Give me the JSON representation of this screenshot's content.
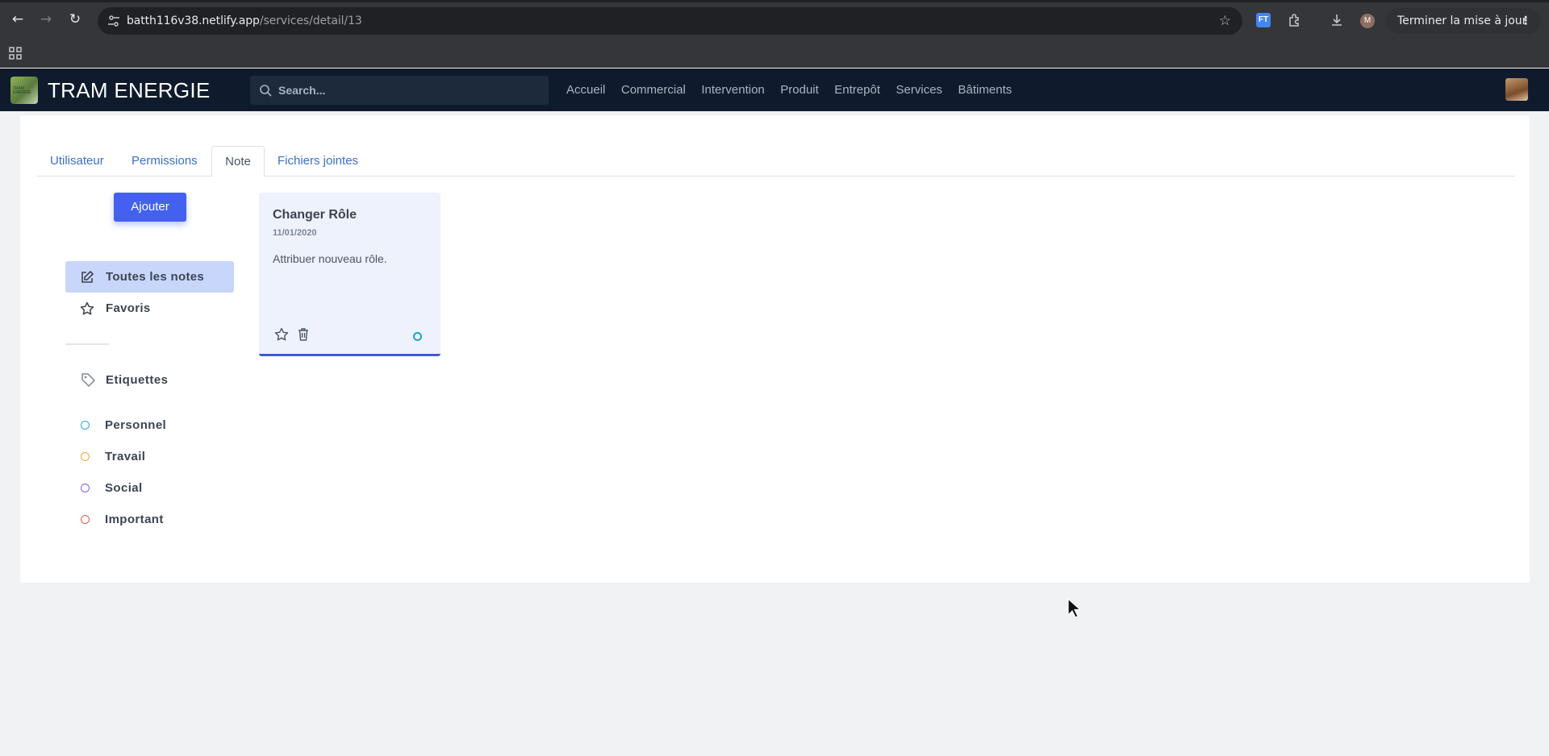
{
  "browser": {
    "url_host": "batth116v38.netlify.app",
    "url_path": "/services/detail/13",
    "extension_label": "FT",
    "profile_initial": "M",
    "update_button": "Terminer la mise à jour"
  },
  "header": {
    "brand": "TRAM ENERGIE",
    "logo_text": "TRAM ENERGIE",
    "search_placeholder": "Search...",
    "nav": [
      "Accueil",
      "Commercial",
      "Intervention",
      "Produit",
      "Entrepôt",
      "Services",
      "Bâtiments"
    ]
  },
  "tabs": {
    "items": [
      "Utilisateur",
      "Permissions",
      "Note",
      "Fichiers jointes"
    ],
    "active": "Note"
  },
  "notes_panel": {
    "add_button": "Ajouter",
    "filters": [
      {
        "label": "Toutes les notes",
        "icon": "edit-icon",
        "active": true
      },
      {
        "label": "Favoris",
        "icon": "star-icon",
        "active": false
      }
    ],
    "labels_title": "Etiquettes",
    "labels": [
      {
        "label": "Personnel",
        "color": "#2ea7d8"
      },
      {
        "label": "Travail",
        "color": "#e8a93a"
      },
      {
        "label": "Social",
        "color": "#8a63d2"
      },
      {
        "label": "Important",
        "color": "#e25a4a"
      }
    ]
  },
  "notes": [
    {
      "title": "Changer Rôle",
      "date": "11/01/2020",
      "text": "Attribuer nouveau rôle.",
      "tag_color": "#1fa4c4"
    }
  ],
  "colors": {
    "accent": "#4361ee",
    "header_bg": "#0f1b2d",
    "active_filter_bg": "#c9d6fb"
  }
}
